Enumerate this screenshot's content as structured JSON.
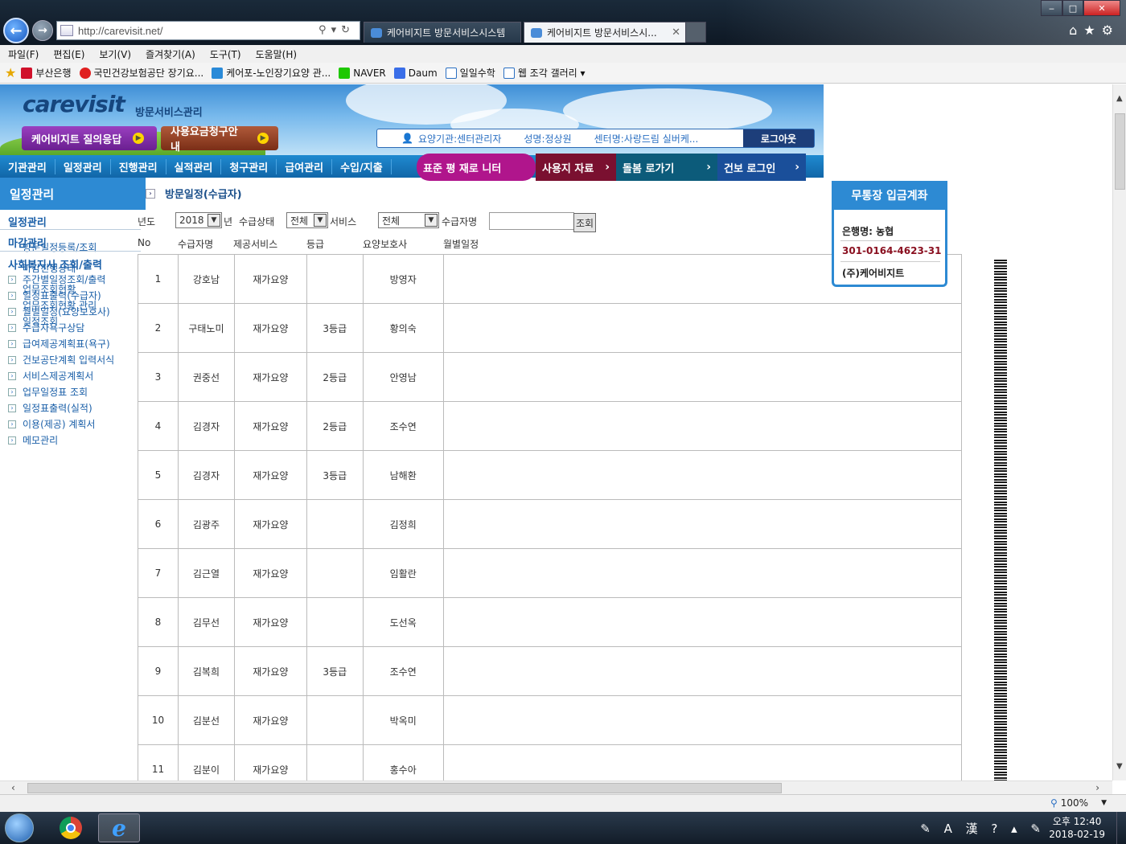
{
  "browser": {
    "url": "http://carevisit.net/",
    "tabs": [
      {
        "label": "케어비지트 방문서비스시스템"
      },
      {
        "label": "케어비지트 방문서비스시...",
        "active": true
      }
    ],
    "menu": [
      "파일(F)",
      "편집(E)",
      "보기(V)",
      "즐겨찾기(A)",
      "도구(T)",
      "도움말(H)"
    ],
    "favorites": [
      {
        "label": "부산은행",
        "color": "#d0112b"
      },
      {
        "label": "국민건강보험공단 장기요...",
        "color": "#e02020"
      },
      {
        "label": "케어포-노인장기요양 관...",
        "color": "#2a8ad8"
      },
      {
        "label": "NAVER",
        "color": "#1ec800"
      },
      {
        "label": "Daum",
        "color": "#3a6ee8"
      },
      {
        "label": "일일수학",
        "color": "#2a6fc2"
      },
      {
        "label": "웹 조각 갤러리 ▾",
        "color": "#2a6fc2"
      }
    ],
    "zoom": "100%"
  },
  "header": {
    "logo": "carevisit",
    "logo_sub": "방문서비스관리",
    "qa_button": "케어비지트 질의응답",
    "fee_button": "사용요금청구안내",
    "user": {
      "org": "요양기관:센터관리자",
      "name": "성명:정상원",
      "center": "센터명:사랑드림 실버케...",
      "logout": "로그아웃"
    }
  },
  "gnb": {
    "items": [
      "기관관리",
      "일정관리",
      "진행관리",
      "실적관리",
      "청구관리",
      "급여관리",
      "수입/지출"
    ],
    "badges": [
      "표준 평 재로 니터",
      "사용지 자료",
      "돌봄 로가기",
      "건보 로그인"
    ]
  },
  "sidebar": {
    "title": "일정관리",
    "sections": [
      "일정관리",
      "마감관리",
      "사회복지사 조회/출력"
    ],
    "overlap_links": [
      "방문일정등록/조회",
      "마감진행상태",
      "사회복지사 조회/출력"
    ],
    "links": [
      "주간별일정조회/출력",
      "업무조회현황",
      "일정표출력(수급자)",
      "업무조회현황 관리",
      "월별일정(요양보호사)",
      "일정조회",
      "수급자욕구상담",
      "급여제공계획표(욕구)",
      "건보공단계획 입력서식",
      "서비스제공계획서",
      "업무일정표 조회",
      "일정표출력(실적)",
      "이용(제공) 계획서",
      "메모관리"
    ]
  },
  "content": {
    "title": "방문일정(수급자)",
    "filters": {
      "year_label": "년도",
      "year_value": "2018",
      "year_suffix": "년",
      "status_label": "수급상태",
      "status_value": "전체",
      "service_label": "서비스",
      "service_value": "전체",
      "name_label": "수급자명",
      "search_button": "조회"
    },
    "columns": [
      "No",
      "수급자명",
      "제공서비스",
      "등급",
      "요양보호사",
      "월별일정"
    ],
    "rows": [
      {
        "no": "1",
        "name": "강호남",
        "service": "재가요양",
        "grade": "",
        "caregiver": "방영자"
      },
      {
        "no": "2",
        "name": "구태노미",
        "service": "재가요양",
        "grade": "3등급",
        "caregiver": "황의숙"
      },
      {
        "no": "3",
        "name": "권중선",
        "service": "재가요양",
        "grade": "2등급",
        "caregiver": "안영남"
      },
      {
        "no": "4",
        "name": "김경자",
        "service": "재가요양",
        "grade": "2등급",
        "caregiver": "조수연"
      },
      {
        "no": "5",
        "name": "김경자",
        "service": "재가요양",
        "grade": "3등급",
        "caregiver": "남해환"
      },
      {
        "no": "6",
        "name": "김광주",
        "service": "재가요양",
        "grade": "",
        "caregiver": "김정희"
      },
      {
        "no": "7",
        "name": "김근열",
        "service": "재가요양",
        "grade": "",
        "caregiver": "임활란"
      },
      {
        "no": "8",
        "name": "김무선",
        "service": "재가요양",
        "grade": "",
        "caregiver": "도선옥"
      },
      {
        "no": "9",
        "name": "김복희",
        "service": "재가요양",
        "grade": "3등급",
        "caregiver": "조수연"
      },
      {
        "no": "10",
        "name": "김분선",
        "service": "재가요양",
        "grade": "",
        "caregiver": "박옥미"
      },
      {
        "no": "11",
        "name": "김분이",
        "service": "재가요양",
        "grade": "",
        "caregiver": "홍수아"
      }
    ]
  },
  "deposit": {
    "title": "무통장 입금계좌",
    "bank": "은행명: 농협",
    "account": "301-0164-4623-31",
    "account_color": "#8a1020",
    "owner": "(주)케어비지트"
  },
  "taskbar": {
    "time": "오후 12:40",
    "date": "2018-02-19"
  }
}
